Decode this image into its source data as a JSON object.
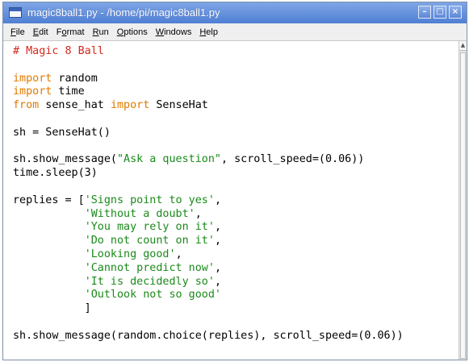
{
  "window": {
    "title": "magic8ball1.py - /home/pi/magic8ball1.py",
    "controls": [
      "minimize-icon",
      "maximize-icon",
      "close-icon"
    ]
  },
  "menu": {
    "items": [
      {
        "pre": "",
        "u": "F",
        "post": "ile"
      },
      {
        "pre": "",
        "u": "E",
        "post": "dit"
      },
      {
        "pre": "F",
        "u": "o",
        "post": "rmat"
      },
      {
        "pre": "",
        "u": "R",
        "post": "un"
      },
      {
        "pre": "",
        "u": "O",
        "post": "ptions"
      },
      {
        "pre": "",
        "u": "W",
        "post": "indows"
      },
      {
        "pre": "",
        "u": "H",
        "post": "elp"
      }
    ]
  },
  "editor": {
    "lines": [
      [
        {
          "t": "# Magic 8 Ball",
          "c": "comment"
        }
      ],
      [],
      [
        {
          "t": "import",
          "c": "keyword"
        },
        {
          "t": " random",
          "c": ""
        }
      ],
      [
        {
          "t": "import",
          "c": "keyword"
        },
        {
          "t": " time",
          "c": ""
        }
      ],
      [
        {
          "t": "from",
          "c": "keyword"
        },
        {
          "t": " sense_hat ",
          "c": ""
        },
        {
          "t": "import",
          "c": "keyword"
        },
        {
          "t": " SenseHat",
          "c": ""
        }
      ],
      [],
      [
        {
          "t": "sh = SenseHat()",
          "c": ""
        }
      ],
      [],
      [
        {
          "t": "sh.show_message(",
          "c": ""
        },
        {
          "t": "\"Ask a question\"",
          "c": "string"
        },
        {
          "t": ", scroll_speed=(0.06))",
          "c": ""
        }
      ],
      [
        {
          "t": "time.sleep(3)",
          "c": ""
        }
      ],
      [],
      [
        {
          "t": "replies = [",
          "c": ""
        },
        {
          "t": "'Signs point to yes'",
          "c": "string"
        },
        {
          "t": ",",
          "c": ""
        }
      ],
      [
        {
          "t": "           ",
          "c": ""
        },
        {
          "t": "'Without a doubt'",
          "c": "string"
        },
        {
          "t": ",",
          "c": ""
        }
      ],
      [
        {
          "t": "           ",
          "c": ""
        },
        {
          "t": "'You may rely on it'",
          "c": "string"
        },
        {
          "t": ",",
          "c": ""
        }
      ],
      [
        {
          "t": "           ",
          "c": ""
        },
        {
          "t": "'Do not count on it'",
          "c": "string"
        },
        {
          "t": ",",
          "c": ""
        }
      ],
      [
        {
          "t": "           ",
          "c": ""
        },
        {
          "t": "'Looking good'",
          "c": "string"
        },
        {
          "t": ",",
          "c": ""
        }
      ],
      [
        {
          "t": "           ",
          "c": ""
        },
        {
          "t": "'Cannot predict now'",
          "c": "string"
        },
        {
          "t": ",",
          "c": ""
        }
      ],
      [
        {
          "t": "           ",
          "c": ""
        },
        {
          "t": "'It is decidedly so'",
          "c": "string"
        },
        {
          "t": ",",
          "c": ""
        }
      ],
      [
        {
          "t": "           ",
          "c": ""
        },
        {
          "t": "'Outlook not so good'",
          "c": "string"
        }
      ],
      [
        {
          "t": "           ]",
          "c": ""
        }
      ],
      [],
      [
        {
          "t": "sh.show_message(random.choice(replies), scroll_speed=(0.06))",
          "c": ""
        }
      ]
    ]
  },
  "colors": {
    "titlebar": "#4f7fd3",
    "comment": "#d4281c",
    "keyword": "#e07a00",
    "string": "#1a8a1a"
  }
}
